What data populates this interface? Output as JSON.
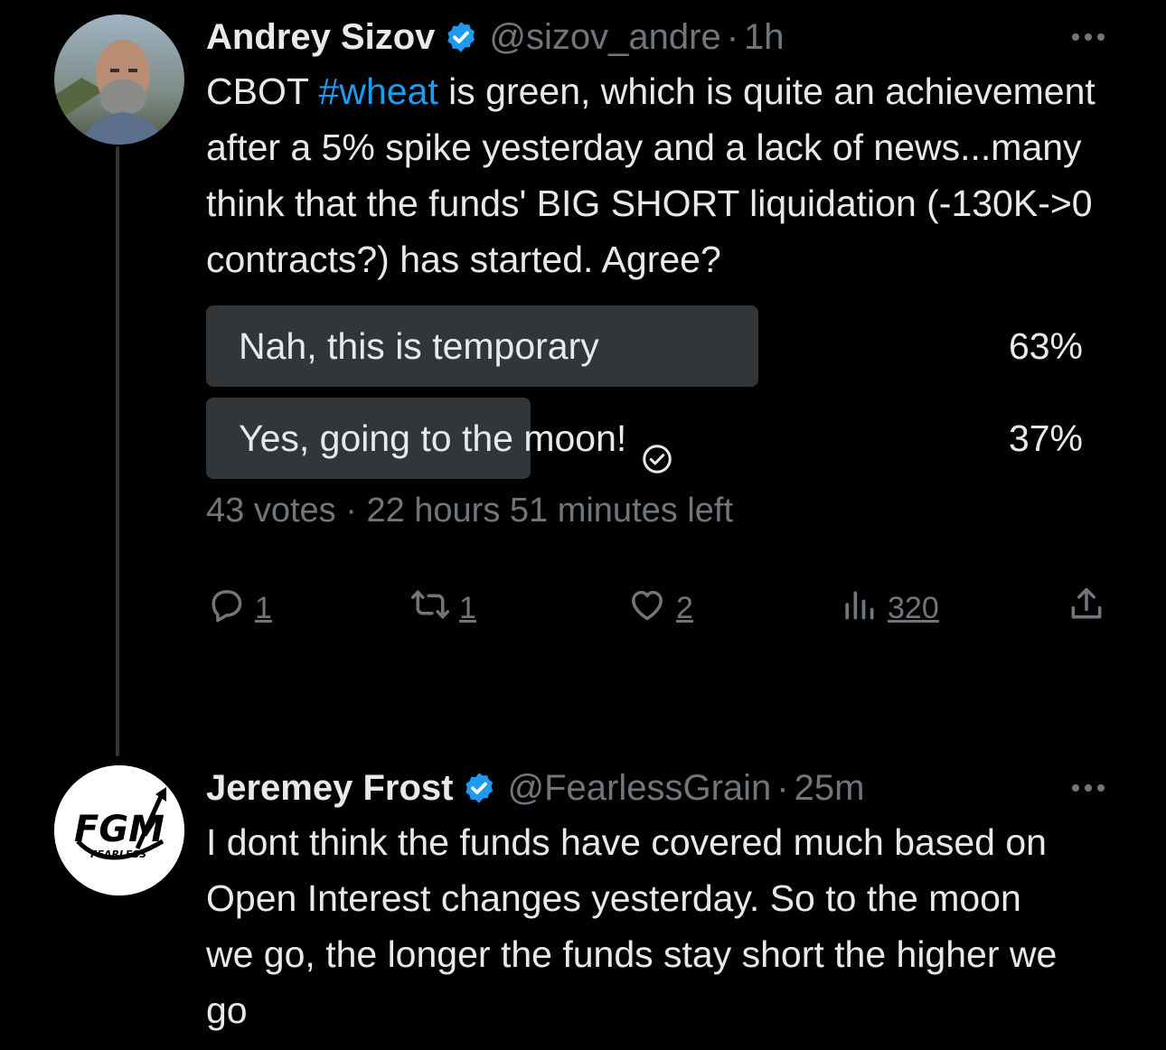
{
  "thread": [
    {
      "author": {
        "name": "Andrey Sizov",
        "handle": "@sizov_andre",
        "time": "1h",
        "separator": "·"
      },
      "text_before": "CBOT ",
      "hashtag": "#wheat",
      "text_after": " is green, which is quite an achievement after a 5% spike yesterday and a lack of news...many think that the funds' BIG SHORT liquidation (-130K->0 contracts?) has started. Agree?",
      "poll": {
        "options": [
          {
            "label": "Nah, this is temporary",
            "percent_text": "63%",
            "fraction": 0.63,
            "selected": false
          },
          {
            "label": "Yes, going to the moon!",
            "percent_text": "37%",
            "fraction": 0.37,
            "selected": true
          }
        ],
        "votes": "43 votes",
        "separator": "·",
        "time_left": "22 hours 51 minutes left"
      },
      "actions": {
        "replies": "1",
        "retweets": "1",
        "likes": "2",
        "views": "320"
      }
    },
    {
      "author": {
        "name": "Jeremey Frost",
        "handle": "@FearlessGrain",
        "time": "25m",
        "separator": "·"
      },
      "avatar_logo_text": "FGM",
      "avatar_logo_subtext": "FEARLESS",
      "text": "I dont think the funds have covered much based on Open Interest changes yesterday. So to the moon we go, the longer the funds stay short the higher we go"
    }
  ],
  "colors": {
    "background": "#000000",
    "text": "#e7e9ea",
    "muted": "#71767b",
    "accent": "#1d9bf0",
    "poll_fill": "#333639"
  },
  "icons": [
    "verified-badge-icon",
    "more-icon",
    "reply-icon",
    "retweet-icon",
    "like-icon",
    "views-icon",
    "share-icon",
    "check-circle-icon"
  ]
}
